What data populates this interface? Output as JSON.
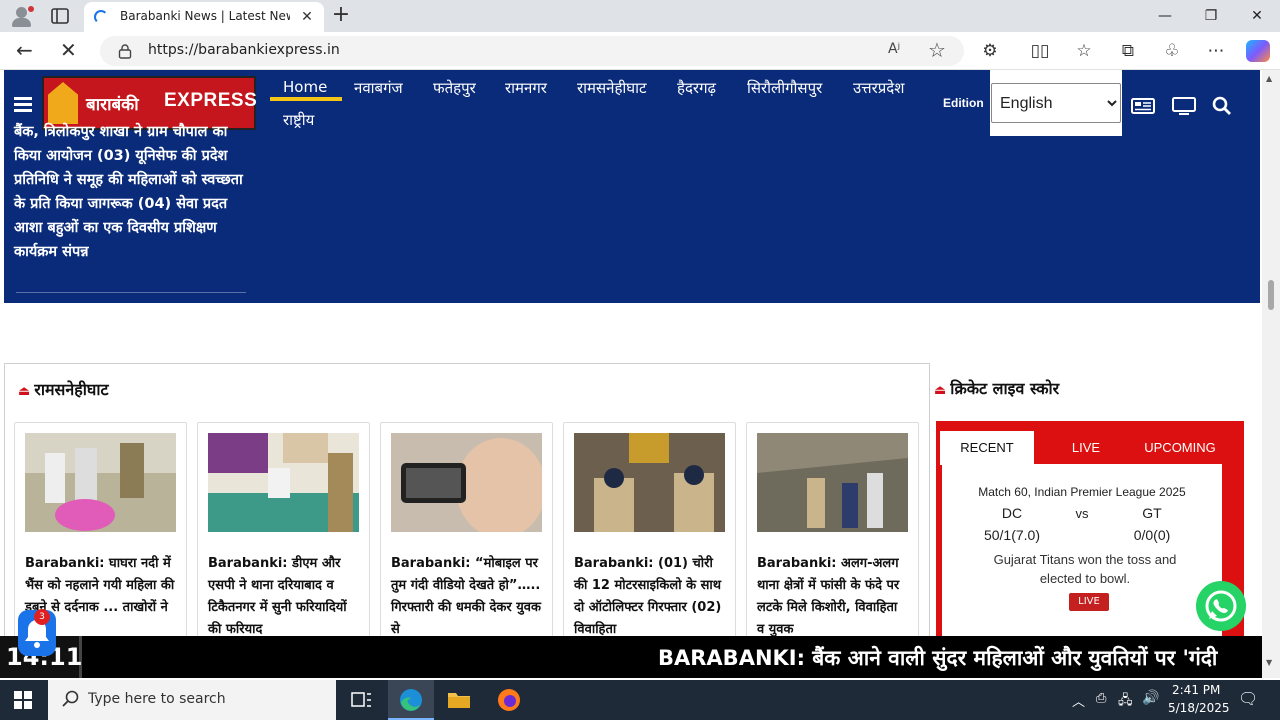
{
  "browser": {
    "tab_title": "Barabanki News | Latest News | L",
    "url": "https://barabankiexpress.in",
    "new_tab": "+",
    "close": "✕"
  },
  "site": {
    "logo_hindi": "बाराबंकी",
    "logo_english": "EXPRESS",
    "nav": [
      {
        "label": "Home"
      },
      {
        "label": "नवाबगंज"
      },
      {
        "label": "फतेहपुर"
      },
      {
        "label": "रामनगर"
      },
      {
        "label": "रामसनेहीघाट"
      },
      {
        "label": "हैदरगढ़"
      },
      {
        "label": "सिरौलीगौसपुर"
      },
      {
        "label": "उत्तरप्रदेश"
      },
      {
        "label": "राष्ट्रीय"
      }
    ],
    "edition_label": "Edition",
    "edition_value": "English",
    "ticker": "बैंक, त्रिलोकपुर शाखा ने ग्राम चौपाल का किया आयोजन (03) यूनिसेफ की प्रदेश प्रतिनिधि ने समूह की महिलाओं को स्वच्छता के प्रति किया जागरूक (04) सेवा प्रदत आशा बहुओं का एक दिवसीय प्रशिक्षण कार्यक्रम संपन्न"
  },
  "section": {
    "title": "रामसनेहीघाट",
    "cards": [
      {
        "title": "Barabanki: घाघरा नदी में भैंस को नहलाने गयी महिला की डूबने से दर्दनाक ... ताखोरों ने दूसरे"
      },
      {
        "title": "Barabanki: डीएम और एसपी ने थाना दरियाबाद व टिकैतनगर में सुनी फरियादियों की फरियाद"
      },
      {
        "title": "Barabanki: “मोबाइल पर तुम गंदी वीडियो देखते हो”….. गिरफ्तारी की धमकी देकर युवक से"
      },
      {
        "title": "Barabanki: (01) चोरी की 12 मोटरसाइकिलो के साथ दो ऑटोलिफ्टर गिरफ्तार (02) विवाहिता"
      },
      {
        "title": "Barabanki: अलग-अलग थाना क्षेत्रों में फांसी के फंदे पर लटके मिले किशोरी, विवाहिता व युवक"
      }
    ]
  },
  "cricket": {
    "title": "क्रिकेट लाइव स्कोर",
    "tabs": [
      "RECENT",
      "LIVE",
      "UPCOMING"
    ],
    "match": "Match 60, Indian Premier League 2025",
    "team1": "DC",
    "vs": "vs",
    "team2": "GT",
    "score1": "50/1(7.0)",
    "score2": "0/0(0)",
    "status": "Gujarat Titans won the toss and elected to bowl.",
    "badge": "LIVE"
  },
  "breaking": {
    "label": "14:11",
    "text": "BARABANKI: बैंक आने वाली सुंदर महिलाओं और युवतियों पर 'गंदी"
  },
  "notifications": {
    "count": "3"
  },
  "taskbar": {
    "search_placeholder": "Type here to search",
    "time": "2:41 PM",
    "date": "5/18/2025"
  }
}
